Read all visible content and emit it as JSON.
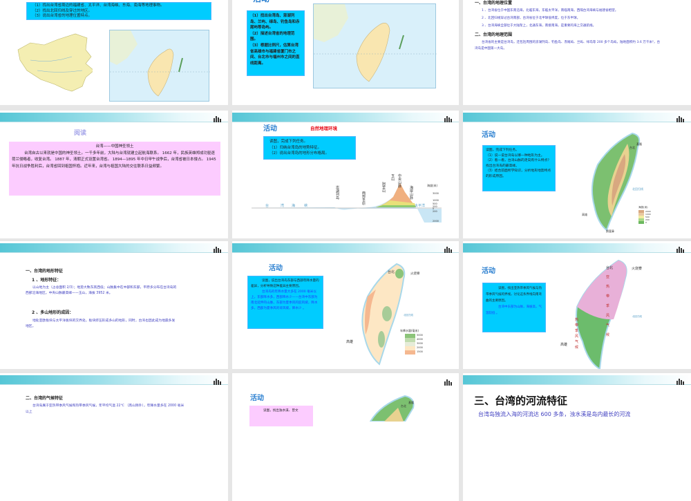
{
  "slides": [
    {
      "tasks": [
        "（1）找出台湾省周边的福建省、太平洋、台湾海峡、东海、南海等地理事物。",
        "（2）找出北回归线及穿过的地区。",
        "（3）说出台湾省的地理位置特点。"
      ]
    },
    {
      "title": "活动",
      "tasks": [
        "（1）找出台湾岛、澎湖列岛、兰屿、绿岛、钓鱼岛和赤尾屿等岛屿。",
        "（2）描述台湾省的地理范围。",
        "（3）根据比例尺，估算台湾省高雄市与福建省厦门市之间、台北市与福州市之间的直线距离。"
      ]
    },
    {
      "h1": "一、台湾的地理位置",
      "items": [
        "1 、台湾省位于中国东南沿海，北临东海，东临太平洋，南临南海，西隔台湾海峡与福建省相望。",
        "2 、北回归线穿过台湾南部，台湾省位于北半球低纬度，位于东半球。",
        "3 、台湾海峡全部位于大陆架上，北通东海，南接南海，是重要的海上交通航线。"
      ],
      "h2": "二、台湾的地理范围",
      "p": "台湾省的主要是台湾岛，还包括周围的澎湖列岛、钓鱼岛、赤尾屿、兰屿、绿岛等 200 多个岛屿，陆地面积约 3.6 万千米²，台湾岛是中国第一大岛。"
    },
    {
      "title": "阅读",
      "box_title": "台湾——中国神圣领土",
      "box_text": "台湾自古以来就是中国的神圣领土。一千多年前，大陆与台湾就建立起航海联系。 1662 年，民族英雄郑成功驱逐荷兰侵略者，收复台湾。 1887 年，清朝正式设置台湾省。 1894—1895 年中日甲午战争后，台湾省被日本侵占。 1945 年抗日战争胜利后，台湾省回到祖国怀抱。近年来，台湾与祖国大陆的交往联系日益频繁。"
    },
    {
      "title": "活动",
      "subtitle": "自然地理环境",
      "tasks": [
        "读图，完成下列任务。",
        "（1）归纳台湾岛的地势特征。",
        "（2）说出台湾岛的地形分布格局。"
      ],
      "profile_labels": [
        "台",
        "湾",
        "海",
        "峡",
        "澎湖列岛",
        "西部平原",
        "阿里山",
        "玉山",
        "中央山脉",
        "海岸山脉",
        "太平洋"
      ],
      "axis_title": "海拔(米)",
      "axis_ticks": [
        "3000",
        "1000",
        "500",
        "200",
        "0",
        "200",
        "2000"
      ]
    },
    {
      "title": "活动",
      "tasks": [
        "读图，完成下列任务。",
        "（1）说一说台湾岛以哪一种地形为主。",
        "（2）看一看，台湾山脉的走向有什么特点？找出台湾岛的最高峰。",
        "（3）结合前面所学知识，分析地形地势特点的形成原因。"
      ],
      "map_labels": [
        "基隆",
        "台北",
        "高雄",
        "鹅銮鼻",
        "北回归线"
      ],
      "legend_title": "海拔(米)",
      "legend": [
        "2000",
        "1000",
        "500",
        "200",
        "0"
      ]
    },
    {
      "h1": "一、台湾的地形特征",
      "s1": "1 、地形特征：",
      "p1": "以山地为主（占总面积 2/3）；地势大致东高西低；山脉集中在中部和东部，平原多分布在台湾岛的西部沿海地区。中央山脉最高峰——玉山，海拔 3952 米。",
      "s2": "2 、多山地形的成因：",
      "p2": "地处亚欧板块与太平洋板块的交界处，板块挤压形成多山的地形，同时，台湾也因此成为地震多发地区。"
    },
    {
      "title": "活动",
      "q": "读图，说出台湾岛东部与西部年降水量的差异，分析导致这种差异主要原因。",
      "a": "台湾岛的年降水量大多在 2000 毫米以上，东部降水多，西部降水少——台湾中东部为南北延伸的山脉，东部为夏季风的迎风坡，降水多，西部为夏季风的背风坡，降水少 。",
      "map_labels": [
        "台北",
        "火烧寮",
        "高雄",
        "北回归线"
      ],
      "legend_title": "年降水量(毫米)",
      "legend": [
        "5000",
        "4000",
        "3000",
        "2000",
        "1500"
      ]
    },
    {
      "title": "活动",
      "q": "读图，找出亚热带季风气候与热带季风气候的界线，讨论这条界线向南弯曲的主要原因。",
      "a": "台湾中东部为山脉，海拔高，气温较低 。",
      "map_labels": [
        "台北",
        "火烧寮",
        "高雄",
        "北回归线"
      ],
      "zone1": "亚热带季风气候",
      "zone2": "热带季风气候"
    },
    {
      "h1": "二、台湾的气候特征",
      "p": "台湾岛属于亚热带季风气候和热带季风气候，年平均气温 22℃ （高山除外），年降水量多在 2000 毫米以上"
    },
    {
      "title": "活动",
      "q": "读图，找出浊水溪、曾文",
      "map_labels": [
        "基隆",
        "台北"
      ]
    },
    {
      "title": "三、台湾的河流特征",
      "p": "台湾岛独流入海的河流达 600 多条，浊水溪是岛内最长的河流"
    }
  ],
  "colors": {
    "task_box": "#00ccff",
    "reading_box": "#fcccff",
    "body_text": "#4040c0",
    "activity_title": "#2a7fd0",
    "red_title": "#e8101c"
  }
}
